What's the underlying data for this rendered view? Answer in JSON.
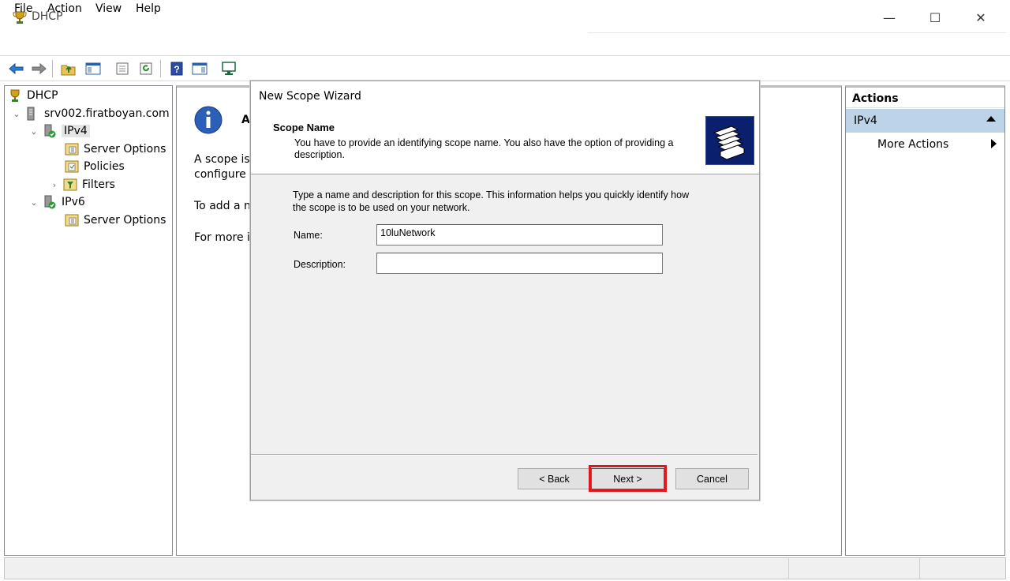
{
  "window": {
    "title": "DHCP",
    "controls": {
      "minimize": "—",
      "maximize": "☐",
      "close": "✕"
    }
  },
  "menu": [
    "File",
    "Action",
    "View",
    "Help"
  ],
  "toolbar": {
    "icons": [
      "back-arrow-icon",
      "forward-arrow-icon",
      "up-folder-icon",
      "show-hide-tree-icon",
      "export-list-icon",
      "refresh-icon",
      "help-icon",
      "show-hide-action-pane-icon",
      "monitor-icon"
    ]
  },
  "tree": {
    "root": "DHCP",
    "server": "srv002.firatboyan.com",
    "ipv4": "IPv4",
    "ipv4_children": [
      "Server Options",
      "Policies",
      "Filters"
    ],
    "ipv6": "IPv6",
    "ipv6_children": [
      "Server Options"
    ]
  },
  "center": {
    "heading_fragment": "A",
    "line1": "A scope is a",
    "line2": "configure a",
    "line3": "To add a ne",
    "line4": "For more in"
  },
  "actions": {
    "header": "Actions",
    "section": "IPv4",
    "more": "More Actions"
  },
  "wizard": {
    "title": "New Scope Wizard",
    "header_title": "Scope Name",
    "header_desc": "You have to provide an identifying scope name. You also have the option of providing a description.",
    "intro": "Type a name and description for this scope. This information helps you quickly identify how the scope is to be used on your network.",
    "name_label": "Name:",
    "name_value": "10luNetwork",
    "desc_label": "Description:",
    "desc_value": "",
    "back": "< Back",
    "next": "Next >",
    "cancel": "Cancel",
    "highlight_color": "#e0161f"
  }
}
